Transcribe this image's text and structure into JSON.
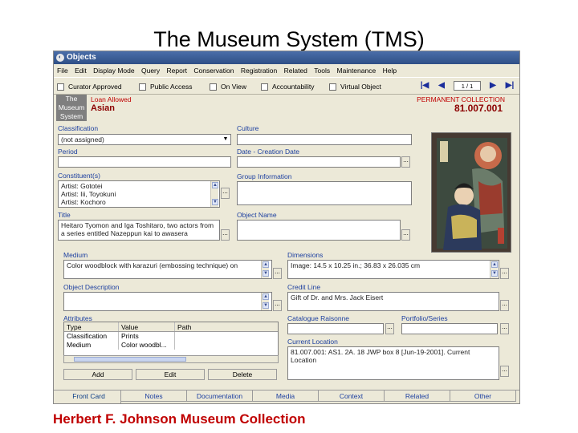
{
  "slide": {
    "title": "The Museum System (TMS)",
    "caption": "Herbert F. Johnson Museum Collection"
  },
  "window": {
    "title": "Objects",
    "menu": [
      "File",
      "Edit",
      "Display Mode",
      "Query",
      "Report",
      "Conservation",
      "Registration",
      "Related",
      "Tools",
      "Maintenance",
      "Help"
    ],
    "checkboxes": [
      "Curator Approved",
      "Public Access",
      "On View",
      "Accountability",
      "Virtual Object"
    ],
    "record_counter": "1 / 1"
  },
  "header": {
    "logo_text": [
      "The",
      "Museum",
      "System"
    ],
    "loan_label": "Loan Allowed",
    "department": "Asian",
    "collection_label": "PERMANENT COLLECTION",
    "object_number": "81.007.001"
  },
  "fields": {
    "classification_label": "Classification",
    "classification_value": "(not assigned)",
    "culture_label": "Culture",
    "period_label": "Period",
    "date_label": "Date - Creation Date",
    "constituents_label": "Constituent(s)",
    "constituents": [
      "Artist:  Gototei",
      "Artist:  Iii, Toyokuni",
      "Artist:  Kochoro"
    ],
    "group_label": "Group Information",
    "title_label": "Title",
    "title_value": "Heitaro Tyomon and Iga Toshitaro, two actors from a series entitled Nazeppun kai to awasera",
    "object_name_label": "Object Name",
    "medium_label": "Medium",
    "medium_value": "Color woodblock with karazuri (embossing technique)  on",
    "dimensions_label": "Dimensions",
    "dimensions_value": "Image: 14.5 x 10.25 in.; 36.83 x 26.035 cm",
    "description_label": "Object Description",
    "credit_label": "Credit Line",
    "credit_value": "Gift of Dr. and Mrs. Jack Eisert",
    "attributes_label": "Attributes",
    "catalogue_label": "Catalogue Raisonne",
    "portfolio_label": "Portfolio/Series",
    "location_label": "Current Location",
    "location_value": "81.007.001: AS1. 2A. 18 JWP box 8 [Jun-19-2001]. Current Location"
  },
  "attributes": {
    "headers": [
      "Type",
      "Value",
      "Path"
    ],
    "rows": [
      [
        "Classification",
        "Prints",
        ""
      ],
      [
        "Medium",
        "Color woodbl...",
        ""
      ]
    ],
    "buttons": [
      "Add",
      "Edit",
      "Delete"
    ]
  },
  "tabs": [
    "Front Card",
    "Notes",
    "Documentation",
    "Media",
    "Context",
    "Related",
    "Other"
  ],
  "icons": {
    "first": "first-record-icon",
    "prev": "previous-record-icon",
    "next": "next-record-icon",
    "last": "last-record-icon"
  }
}
